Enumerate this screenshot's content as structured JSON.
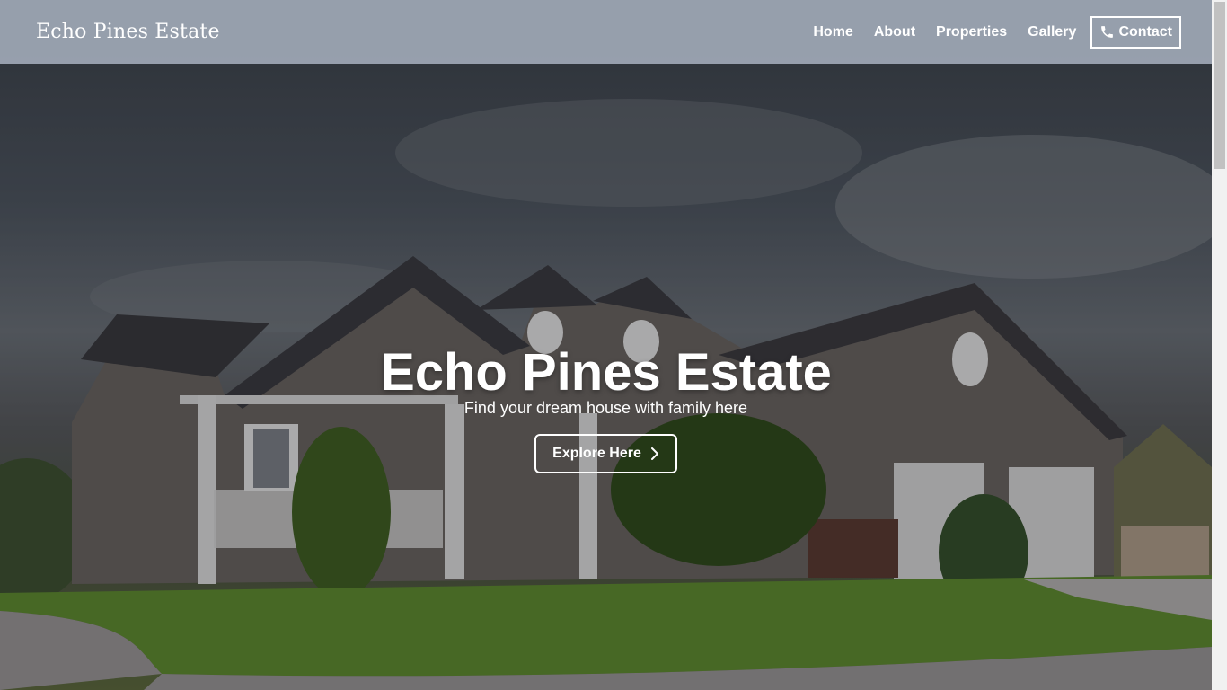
{
  "site": {
    "brand": "Echo Pines Estate"
  },
  "nav": {
    "items": [
      {
        "label": "Home"
      },
      {
        "label": "About"
      },
      {
        "label": "Properties"
      },
      {
        "label": "Gallery"
      }
    ],
    "contact_label": "Contact",
    "contact_icon": "phone-icon"
  },
  "hero": {
    "title": "Echo Pines Estate",
    "subtitle": "Find your dream house with family here",
    "cta_label": "Explore Here",
    "cta_icon": "chevron-right-icon",
    "background_image": "house-with-lawn-photo"
  },
  "colors": {
    "navbar_bg": "#a0a8b6",
    "text": "#ffffff"
  }
}
